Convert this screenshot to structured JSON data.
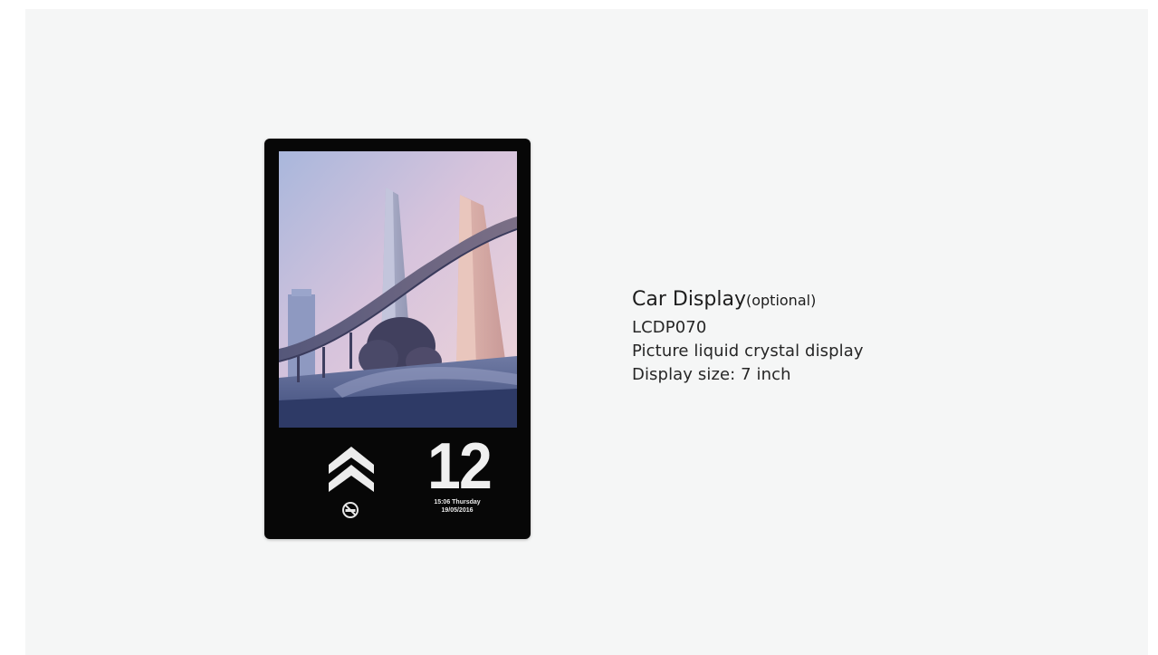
{
  "product": {
    "title": "Car Display",
    "title_suffix": "(optional)",
    "model": "LCDP070",
    "description": "Picture liquid crystal display",
    "size": "Display size: 7 inch"
  },
  "device_display": {
    "floor": "12",
    "time_day": "15:06 Thursday",
    "date": "19/05/2016",
    "direction_icon": "double-chevron-up-icon",
    "status_icon": "no-smoking-icon",
    "photo": "city-skyline-picture"
  },
  "colors": {
    "background": "#f5f6f6",
    "device_bezel": "#070707",
    "text": "#222222"
  }
}
